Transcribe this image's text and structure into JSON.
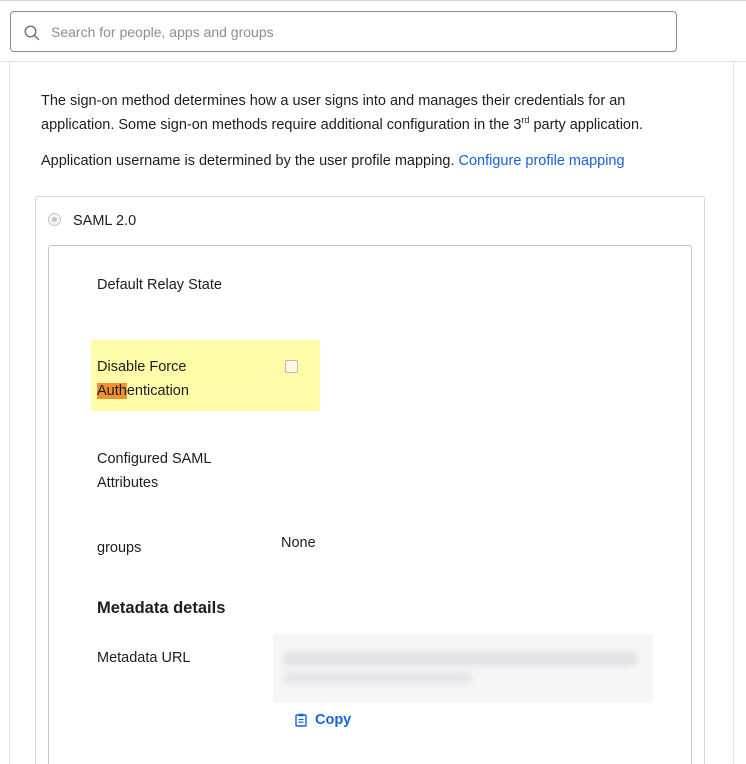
{
  "search": {
    "placeholder": "Search for people, apps and groups"
  },
  "intro": {
    "line1": "The sign-on method determines how a user signs into and manages their credentials for an",
    "line2_prefix": "application. Some sign-on methods require additional configuration in the 3",
    "line2_sup": "rd",
    "line2_suffix": " party application."
  },
  "mapping": {
    "text": "Application username is determined by the user profile mapping.",
    "link": "Configure profile mapping"
  },
  "method": {
    "label": "SAML 2.0"
  },
  "fields": {
    "relay_state": "Default Relay State",
    "force_auth_line1": "Disable Force",
    "force_auth_highlight": "Auth",
    "force_auth_rest": "entication",
    "saml_attributes_line1": "Configured SAML",
    "saml_attributes_line2": "Attributes",
    "groups_label": "groups",
    "groups_value": "None"
  },
  "metadata": {
    "title": "Metadata details",
    "url_label": "Metadata URL",
    "copy_label": "Copy"
  },
  "colors": {
    "link": "#1662dd",
    "highlight": "#fefca8",
    "match": "#f49034"
  },
  "icons": {
    "search": "search-icon",
    "copy": "clipboard-icon"
  }
}
